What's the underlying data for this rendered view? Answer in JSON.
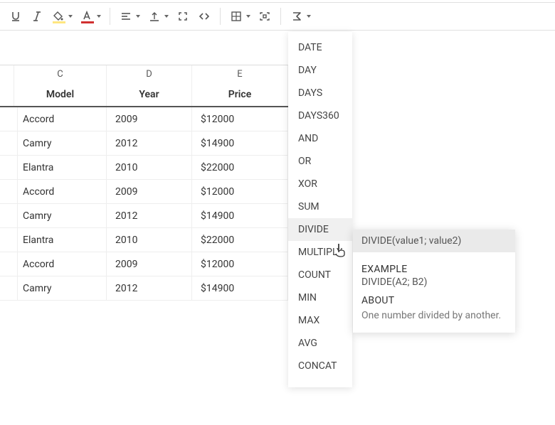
{
  "toolbar": {
    "icons": {
      "underline": "underline-icon",
      "italic": "italic-icon",
      "bgcolor": "background-color-icon",
      "textcolor": "text-color-icon",
      "align": "align-icon",
      "valign": "vertical-align-icon",
      "fullscreen": "fullscreen-icon",
      "code": "code-icon",
      "table": "table-icon",
      "split": "split-cell-icon",
      "formula": "formula-icon"
    }
  },
  "columns": {
    "C": "C",
    "D": "D",
    "E": "E"
  },
  "headers": {
    "model": "Model",
    "year": "Year",
    "price": "Price"
  },
  "rows": [
    {
      "model": "Accord",
      "year": "2009",
      "price": "$12000"
    },
    {
      "model": "Camry",
      "year": "2012",
      "price": "$14900"
    },
    {
      "model": "Elantra",
      "year": "2010",
      "price": "$22000"
    },
    {
      "model": "Accord",
      "year": "2009",
      "price": "$12000"
    },
    {
      "model": "Camry",
      "year": "2012",
      "price": "$14900"
    },
    {
      "model": "Elantra",
      "year": "2010",
      "price": "$22000"
    },
    {
      "model": "Accord",
      "year": "2009",
      "price": "$12000"
    },
    {
      "model": "Camry",
      "year": "2012",
      "price": "$14900"
    }
  ],
  "formula_menu": {
    "items": [
      "DATE",
      "DAY",
      "DAYS",
      "DAYS360",
      "AND",
      "OR",
      "XOR",
      "SUM",
      "DIVIDE",
      "MULTIPLY",
      "COUNT",
      "MIN",
      "MAX",
      "AVG",
      "CONCAT"
    ],
    "hovered_index": 8
  },
  "tooltip": {
    "signature": "DIVIDE(value1; value2)",
    "example_header": "EXAMPLE",
    "example": "DIVIDE(A2; B2)",
    "about_header": "ABOUT",
    "description": "One number divided by another."
  }
}
